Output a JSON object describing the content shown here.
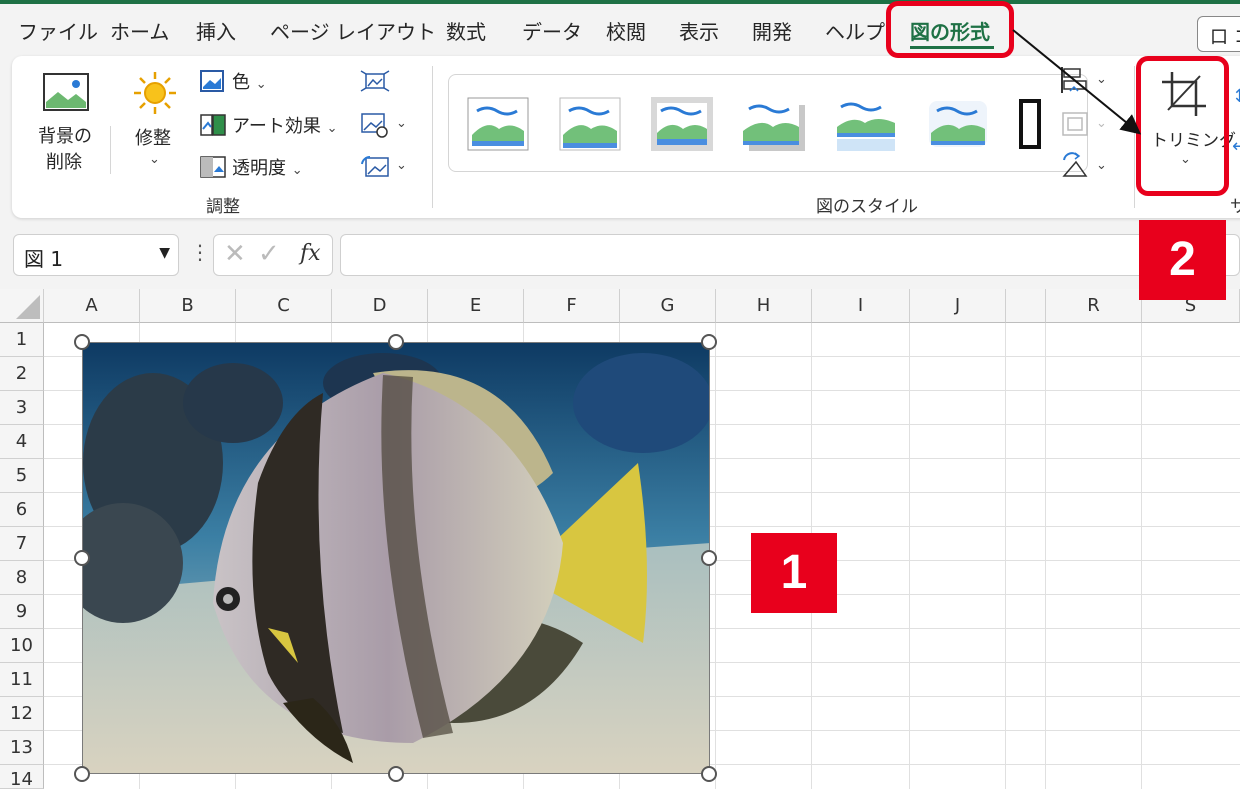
{
  "tabs": {
    "items": [
      "ファイル",
      "ホーム",
      "挿入",
      "ページ レイアウト",
      "数式",
      "データ",
      "校閲",
      "表示",
      "開発",
      "ヘルプ"
    ],
    "active": "図の形式",
    "comment_label": "口 コ"
  },
  "ribbon": {
    "remove_bg": [
      "背景の",
      "削除"
    ],
    "corrections": "修整",
    "color": "色",
    "artistic": "アート効果",
    "transparency": "透明度",
    "adjust_group": "調整",
    "styles_group": "図のスタイル",
    "crop": "トリミング",
    "size_group_partial": "サ"
  },
  "formula_bar": {
    "name_box": "図 1",
    "fx": "fx",
    "value": ""
  },
  "sheet": {
    "columns": [
      "A",
      "B",
      "C",
      "D",
      "E",
      "F",
      "G",
      "H",
      "I",
      "J",
      "R",
      "S"
    ],
    "rows": [
      "1",
      "2",
      "3",
      "4",
      "5",
      "6",
      "7",
      "8",
      "9",
      "10",
      "11",
      "12",
      "13",
      "14"
    ]
  },
  "callouts": {
    "one": "1",
    "two": "2"
  },
  "colors": {
    "accent": "#1e7145",
    "highlight": "#e8001c"
  }
}
